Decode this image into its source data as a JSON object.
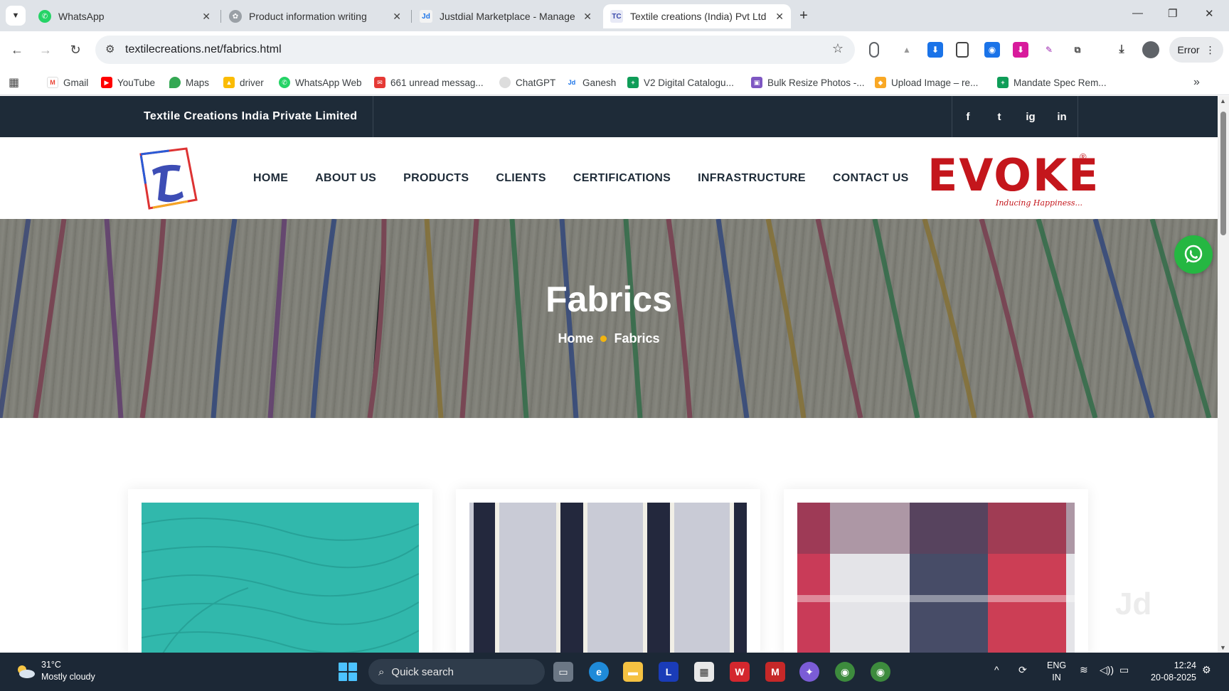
{
  "browser": {
    "tabs": [
      {
        "title": "WhatsApp",
        "icon": "whatsapp-icon",
        "active": false
      },
      {
        "title": "Product information writing",
        "icon": "chatgpt-icon",
        "active": false
      },
      {
        "title": "Justdial Marketplace - Manage",
        "icon": "justdial-icon",
        "active": false
      },
      {
        "title": "Textile creations (India) Pvt Ltd",
        "icon": "textile-creations-icon",
        "active": true
      }
    ],
    "url": "textilecreations.net/fabrics.html",
    "profile_status": "Error",
    "bookmarks": [
      {
        "label": "Gmail",
        "icon": "gmail-icon"
      },
      {
        "label": "YouTube",
        "icon": "youtube-icon"
      },
      {
        "label": "Maps",
        "icon": "maps-icon"
      },
      {
        "label": "driver",
        "icon": "google-drive-icon"
      },
      {
        "label": "WhatsApp Web",
        "icon": "whatsapp-icon"
      },
      {
        "label": "661 unread messag...",
        "icon": "mail-icon"
      },
      {
        "label": "ChatGPT",
        "icon": "chatgpt-icon"
      },
      {
        "label": "Ganesh",
        "icon": "justdial-icon"
      },
      {
        "label": "V2 Digital Catalogu...",
        "icon": "sheets-icon"
      },
      {
        "label": "Bulk Resize Photos -...",
        "icon": "photos-icon"
      },
      {
        "label": "Upload Image – re...",
        "icon": "upload-icon"
      },
      {
        "label": "Mandate Spec Rem...",
        "icon": "sheets-icon"
      }
    ]
  },
  "site": {
    "company_name": "Textile Creations India Private Limited",
    "socials": [
      "f",
      "t",
      "ig",
      "in"
    ],
    "menu": [
      "HOME",
      "ABOUT US",
      "PRODUCTS",
      "CLIENTS",
      "CERTIFICATIONS",
      "INFRASTRUCTURE",
      "CONTACT US"
    ],
    "brand": {
      "word": "EVOKE",
      "registered": "®",
      "tagline": "Inducing Happiness..."
    },
    "hero": {
      "title": "Fabrics",
      "breadcrumb_home": "Home",
      "breadcrumb_current": "Fabrics"
    },
    "cards": [
      {
        "name": "teal-fabric"
      },
      {
        "name": "navy-white-stripe-fabric"
      },
      {
        "name": "red-navy-check-fabric"
      }
    ],
    "watermark": "Jd"
  },
  "taskbar": {
    "temperature": "31°C",
    "weather": "Mostly cloudy",
    "search_placeholder": "Quick search",
    "language": "ENG",
    "region": "IN",
    "time": "12:24",
    "date": "20-08-2025"
  },
  "colors": {
    "topbar": "#1e2b38",
    "brand_red": "#c4161c",
    "breadcrumb_dot": "#f2b40f",
    "whatsapp_green": "#25b742"
  }
}
